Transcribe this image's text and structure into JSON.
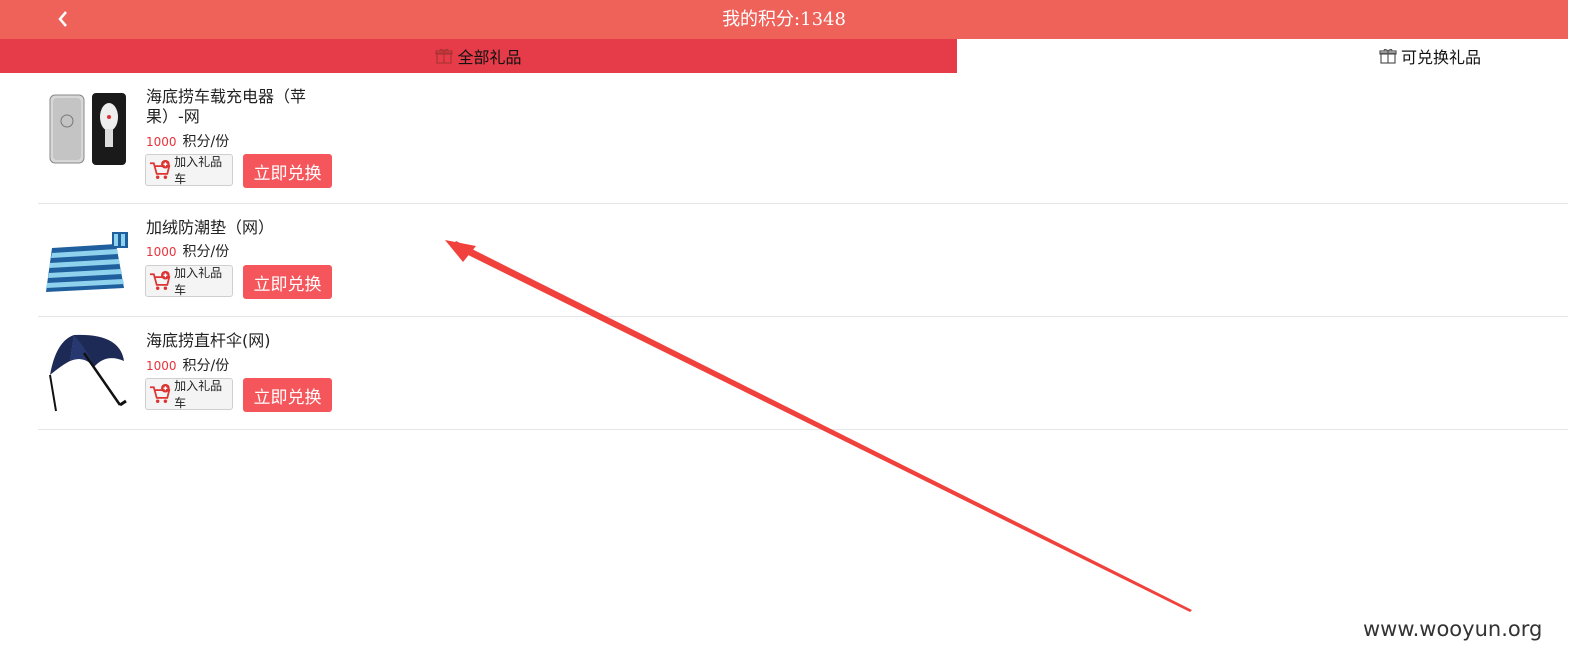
{
  "header": {
    "title": "我的积分:1348",
    "back_icon": "chevron-left-icon"
  },
  "tabs": [
    {
      "label": "全部礼品",
      "icon": "gift-icon",
      "active": true
    },
    {
      "label": "可兑换礼品",
      "icon": "gift-icon",
      "active": false
    }
  ],
  "products": [
    {
      "name": "海底捞车载充电器（苹果）-网",
      "price_value": "1000",
      "price_unit": "积分/份",
      "cart_label": "加入礼品车",
      "exchange_label": "立即兑换",
      "image": "car-charger-image"
    },
    {
      "name": "加绒防潮垫（网）",
      "price_value": "1000",
      "price_unit": "积分/份",
      "cart_label": "加入礼品车",
      "exchange_label": "立即兑换",
      "image": "striped-mat-image"
    },
    {
      "name": "海底捞直杆伞(网)",
      "price_value": "1000",
      "price_unit": "积分/份",
      "cart_label": "加入礼品车",
      "exchange_label": "立即兑换",
      "image": "umbrella-image"
    }
  ],
  "watermark": "www.wooyun.org",
  "colors": {
    "header_bg": "#ee6259",
    "active_tab_bg": "#e63c4a",
    "exchange_btn": "#f4565b",
    "price": "#e8333c",
    "annotation_arrow": "#f0413c"
  }
}
